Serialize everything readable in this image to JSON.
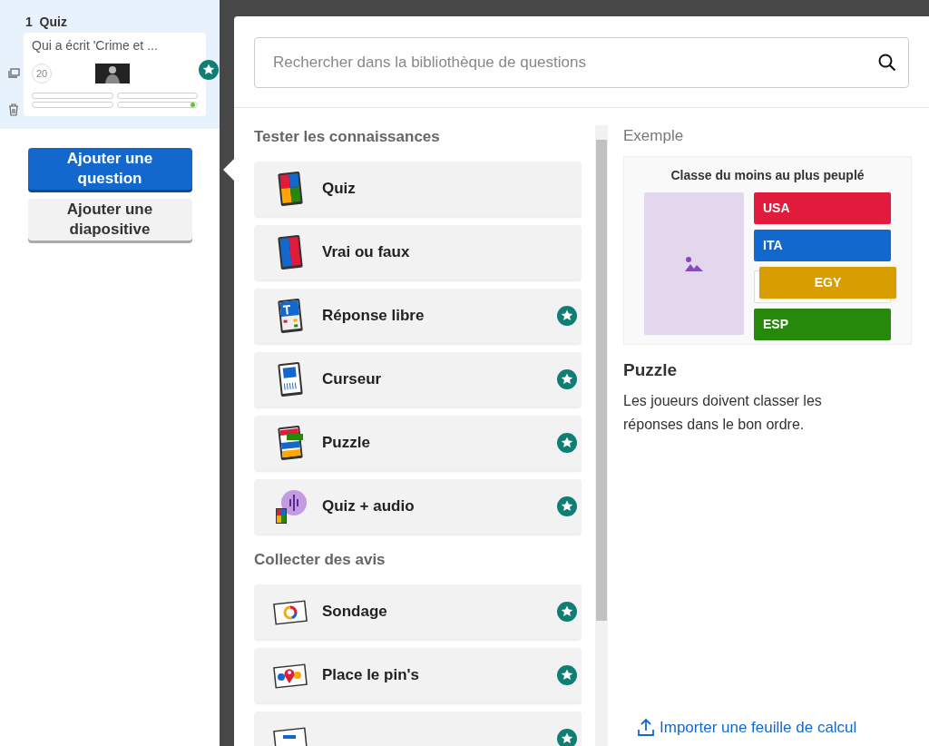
{
  "sidebar": {
    "slide": {
      "number": "1",
      "type": "Quiz",
      "question": "Qui a écrit 'Crime et ...",
      "timer": "20",
      "premium": true,
      "answers": [
        {
          "correct": false
        },
        {
          "correct": false
        },
        {
          "correct": false
        },
        {
          "correct": true
        }
      ]
    },
    "buttons": [
      {
        "label": "Ajouter une question",
        "kind": "primary"
      },
      {
        "label": "Ajouter une diapositive",
        "kind": "secondary"
      }
    ]
  },
  "search": {
    "placeholder": "Rechercher dans la bibliothèque de questions"
  },
  "sections": [
    {
      "title": "Tester les connaissances",
      "items": [
        {
          "label": "Quiz",
          "kind": "quiz",
          "premium": false
        },
        {
          "label": "Vrai ou faux",
          "kind": "truefalse",
          "premium": false
        },
        {
          "label": "Réponse libre",
          "kind": "typeanswer",
          "premium": true
        },
        {
          "label": "Curseur",
          "kind": "slider",
          "premium": true
        },
        {
          "label": "Puzzle",
          "kind": "puzzle",
          "premium": true
        },
        {
          "label": "Quiz + audio",
          "kind": "audio",
          "premium": true
        }
      ]
    },
    {
      "title": "Collecter des avis",
      "items": [
        {
          "label": "Sondage",
          "kind": "poll",
          "premium": true
        },
        {
          "label": "Place le pin's",
          "kind": "pin",
          "premium": true
        },
        {
          "kind": "wordcloud",
          "premium": true
        }
      ]
    }
  ],
  "example": {
    "heading": "Exemple",
    "title": "Classe du moins au plus peuplé",
    "answers": [
      {
        "label": "USA",
        "color": "#e21b3c"
      },
      {
        "label": "ITA",
        "color": "#1368ce"
      },
      {
        "label": "EGY",
        "color": "#d89e00"
      },
      {
        "label": "ESP",
        "color": "#26890c"
      }
    ],
    "name": "Puzzle",
    "description": "Les joueurs doivent classer les réponses dans le bon ordre."
  },
  "import_link": "Importer une feuille de calcul"
}
